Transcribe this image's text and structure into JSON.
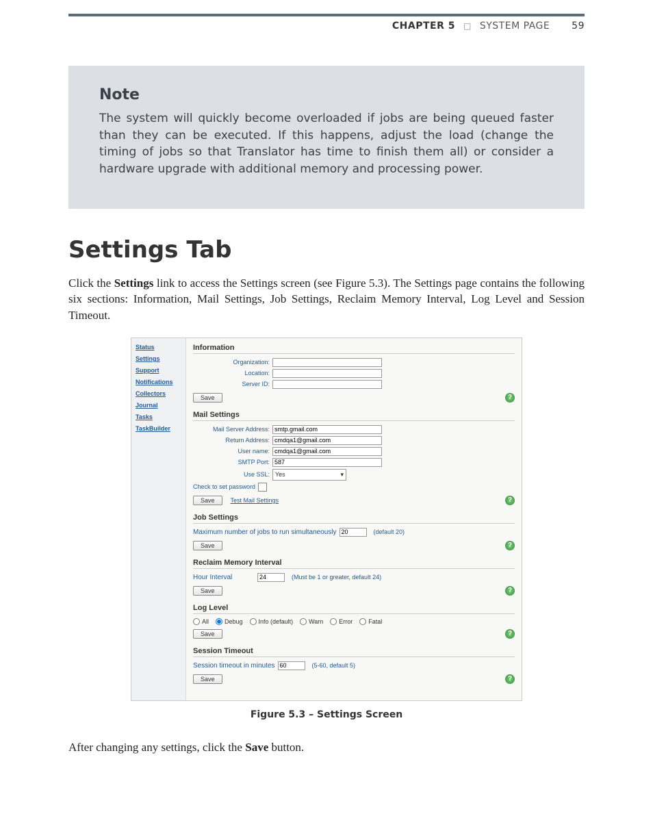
{
  "header": {
    "chapter": "CHAPTER 5",
    "sep": "□",
    "title": "SYSTEM PAGE",
    "page_number": "59"
  },
  "note": {
    "title": "Note",
    "body": "The system will quickly become overloaded if jobs are being queued faster than they can be executed. If this happens, adjust the load (change the timing of jobs so that Translator has time to finish them all) or consider a hardware upgrade with additional memory and processing power."
  },
  "section": {
    "title": "Settings Tab",
    "intro_before": "Click the ",
    "intro_link": "Settings",
    "intro_after": " link to access the Settings screen (see Figure 5.3). The Settings page contains the following six sections: Information, Mail Settings, Job Settings, Reclaim Memory Interval, Log Level and Session Timeout."
  },
  "figure": {
    "sidebar": [
      "Status",
      "Settings",
      "Support",
      "Notifications",
      "Collectors",
      "Journal",
      "Tasks",
      "TaskBuilder"
    ],
    "information": {
      "heading": "Information",
      "org_label": "Organization:",
      "loc_label": "Location:",
      "server_label": "Server ID:",
      "save": "Save"
    },
    "mail": {
      "heading": "Mail Settings",
      "server_label": "Mail Server Address:",
      "server_value": "smtp.gmail.com",
      "return_label": "Return Address:",
      "return_value": "cmdqa1@gmail.com",
      "user_label": "User name:",
      "user_value": "cmdqa1@gmail.com",
      "port_label": "SMTP Port:",
      "port_value": "587",
      "ssl_label": "Use SSL:",
      "ssl_value": "Yes",
      "pwd_label": "Check to set password",
      "save": "Save",
      "test_link": "Test Mail Settings"
    },
    "job": {
      "heading": "Job Settings",
      "label": "Maximum number of jobs to run simultaneously",
      "value": "20",
      "hint": "(default 20)",
      "save": "Save"
    },
    "reclaim": {
      "heading": "Reclaim Memory Interval",
      "label": "Hour Interval",
      "value": "24",
      "hint": "(Must be 1 or greater, default 24)",
      "save": "Save"
    },
    "log": {
      "heading": "Log Level",
      "options": [
        "All",
        "Debug",
        "Info (default)",
        "Warn",
        "Error",
        "Fatal"
      ],
      "selected": "Debug",
      "save": "Save"
    },
    "session": {
      "heading": "Session Timeout",
      "label": "Session timeout in minutes",
      "value": "60",
      "hint": "(5-60, default 5)",
      "save": "Save"
    },
    "help_glyph": "?",
    "caption": "Figure 5.3 – Settings Screen"
  },
  "closing": {
    "before": "After changing any settings, click the ",
    "bold": "Save",
    "after": " button."
  }
}
